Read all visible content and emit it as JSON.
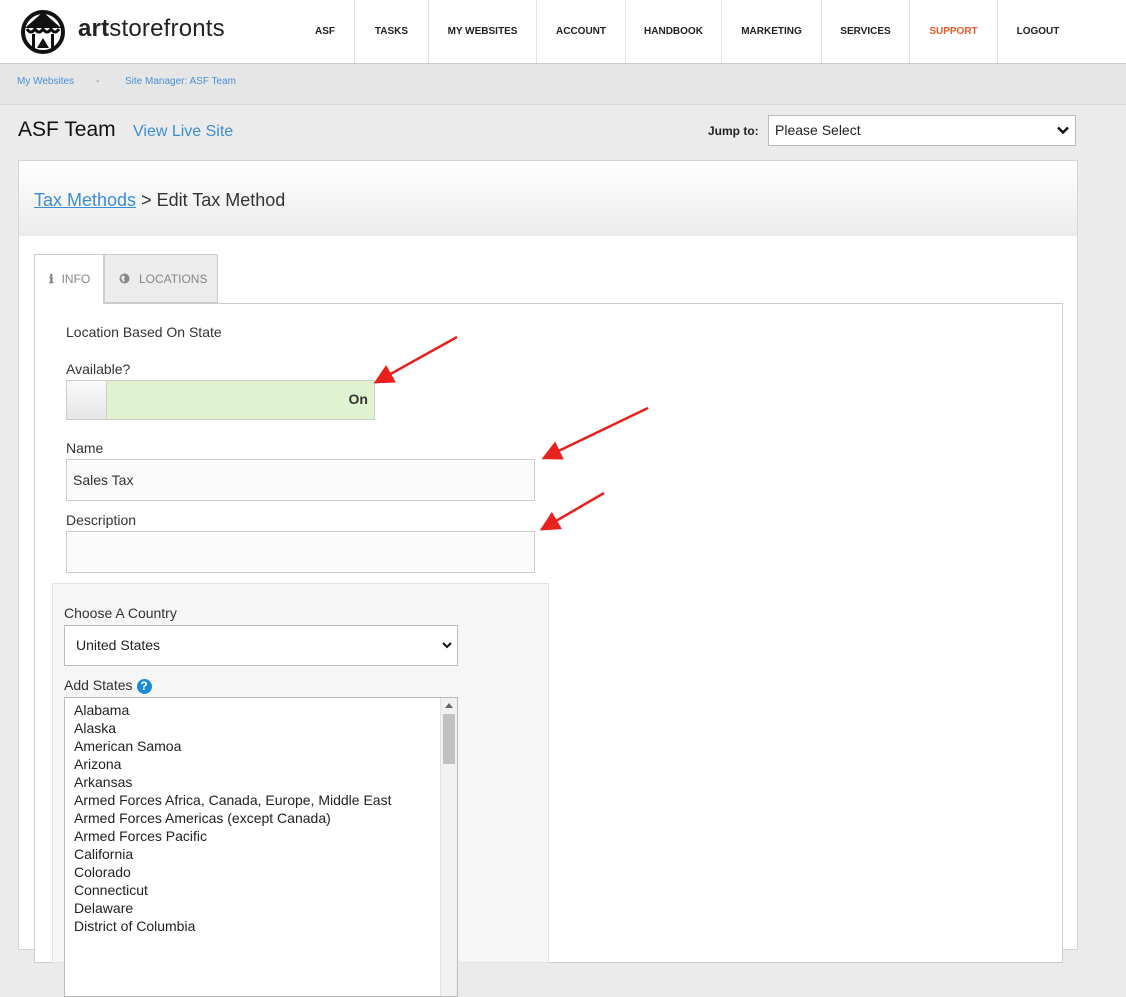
{
  "brand": {
    "name_bold": "art",
    "name_rest": "storefronts"
  },
  "nav": [
    {
      "label": "ASF",
      "name": "nav-asf"
    },
    {
      "label": "TASKS",
      "name": "nav-tasks"
    },
    {
      "label": "MY WEBSITES",
      "name": "nav-my-websites"
    },
    {
      "label": "ACCOUNT",
      "name": "nav-account"
    },
    {
      "label": "HANDBOOK",
      "name": "nav-handbook"
    },
    {
      "label": "MARKETING",
      "name": "nav-marketing"
    },
    {
      "label": "SERVICES",
      "name": "nav-services"
    },
    {
      "label": "SUPPORT",
      "name": "nav-support"
    },
    {
      "label": "LOGOUT",
      "name": "nav-logout"
    }
  ],
  "breadcrumb": {
    "home": "My Websites",
    "separator": "-",
    "current": "Site Manager: ASF Team"
  },
  "site": {
    "title": "ASF Team",
    "view_live": "View Live Site"
  },
  "jump": {
    "label": "Jump to:",
    "value": "Please Select"
  },
  "panel": {
    "parent_link": "Tax Methods",
    "title_suffix": " > Edit Tax Method"
  },
  "tabs": {
    "info": "INFO",
    "locations": "LOCATIONS"
  },
  "form": {
    "method_type": "Location Based On State",
    "available_label": "Available?",
    "available_state": "On",
    "name_label": "Name",
    "name_value": "Sales Tax",
    "description_label": "Description",
    "description_value": "",
    "country_label": "Choose A Country",
    "country_value": "United States",
    "states_label": "Add States",
    "states": [
      "Alabama",
      "Alaska",
      "American Samoa",
      "Arizona",
      "Arkansas",
      "Armed Forces Africa, Canada, Europe, Middle East",
      "Armed Forces Americas (except Canada)",
      "Armed Forces Pacific",
      "California",
      "Colorado",
      "Connecticut",
      "Delaware",
      "District of Columbia"
    ]
  },
  "colors": {
    "accent": "#3b8ed6",
    "support": "#ee5a24",
    "toggle_on": "#dff3d1",
    "annotation": "#e8211d"
  }
}
